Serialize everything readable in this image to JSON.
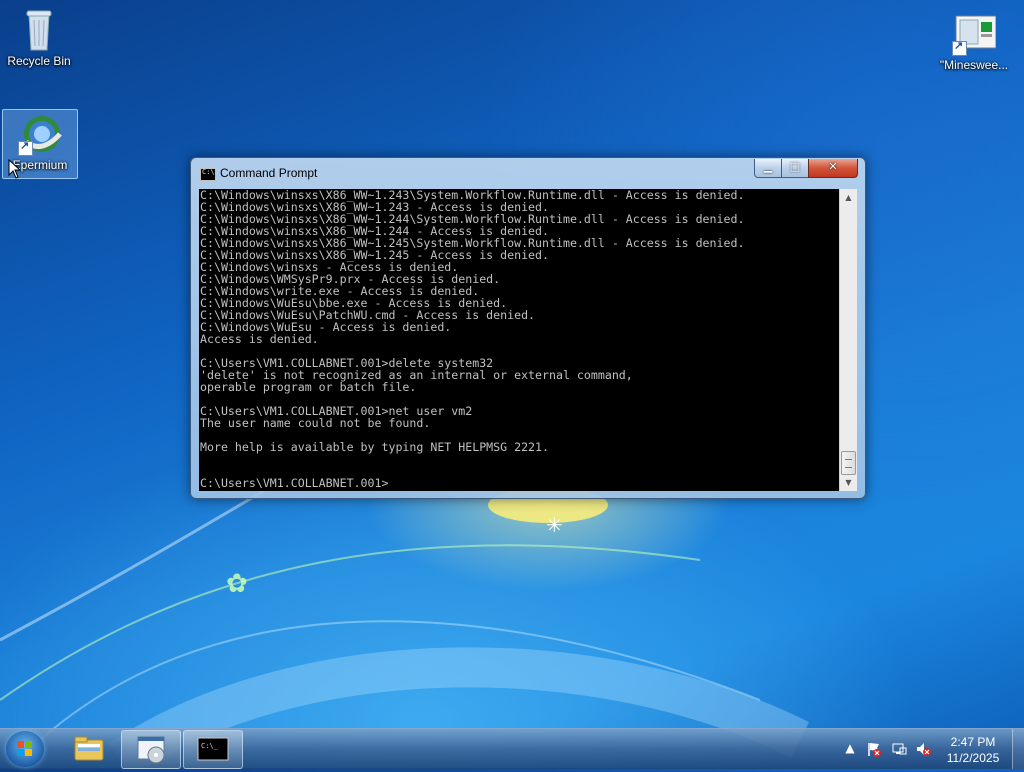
{
  "desktop": {
    "icons": [
      {
        "label": "Recycle Bin",
        "icon": "recycle-bin-icon"
      },
      {
        "label": "Epermium",
        "icon": "epermium-icon"
      },
      {
        "label": "\"Minesweeper\"",
        "display_label": "\"Minesweе...",
        "icon": "minesweeper-shortcut-icon"
      }
    ]
  },
  "window": {
    "title": "Command Prompt",
    "icon": "cmd-icon",
    "controls": {
      "minimize": "minimize-icon",
      "maximize": "maximize-icon",
      "close": "close-icon"
    },
    "console_text": "C:\\Windows\\winsxs\\X86_WW~1.243\\System.Workflow.Runtime.dll - Access is denied.\nC:\\Windows\\winsxs\\X86_WW~1.243 - Access is denied.\nC:\\Windows\\winsxs\\X86_WW~1.244\\System.Workflow.Runtime.dll - Access is denied.\nC:\\Windows\\winsxs\\X86_WW~1.244 - Access is denied.\nC:\\Windows\\winsxs\\X86_WW~1.245\\System.Workflow.Runtime.dll - Access is denied.\nC:\\Windows\\winsxs\\X86_WW~1.245 - Access is denied.\nC:\\Windows\\winsxs - Access is denied.\nC:\\Windows\\WMSysPr9.prx - Access is denied.\nC:\\Windows\\write.exe - Access is denied.\nC:\\Windows\\WuEsu\\bbe.exe - Access is denied.\nC:\\Windows\\WuEsu\\PatchWU.cmd - Access is denied.\nC:\\Windows\\WuEsu - Access is denied.\nAccess is denied.\n\nC:\\Users\\VM1.COLLABNET.001>delete system32\n'delete' is not recognized as an internal or external command,\noperable program or batch file.\n\nC:\\Users\\VM1.COLLABNET.001>net user vm2\nThe user name could not be found.\n\nMore help is available by typing NET HELPMSG 2221.\n\n\nC:\\Users\\VM1.COLLABNET.001>",
    "scroll_position": 0.96
  },
  "taskbar": {
    "start": "windows-start-icon",
    "apps": [
      {
        "name": "Windows Explorer",
        "icon": "folder-icon"
      },
      {
        "name": "Disk Management",
        "icon": "disk-management-icon"
      },
      {
        "name": "Command Prompt",
        "icon": "cmd-icon"
      }
    ],
    "tray": {
      "icons": [
        "show-hidden-icons-arrow",
        "action-center-flag-icon",
        "network-icon",
        "volume-muted-icon"
      ],
      "time": "2:47 PM",
      "date": "11/2/2025"
    }
  },
  "colors": {
    "console_bg": "#000000",
    "console_fg": "#c0c0c0",
    "close_button": "#c9422a"
  }
}
